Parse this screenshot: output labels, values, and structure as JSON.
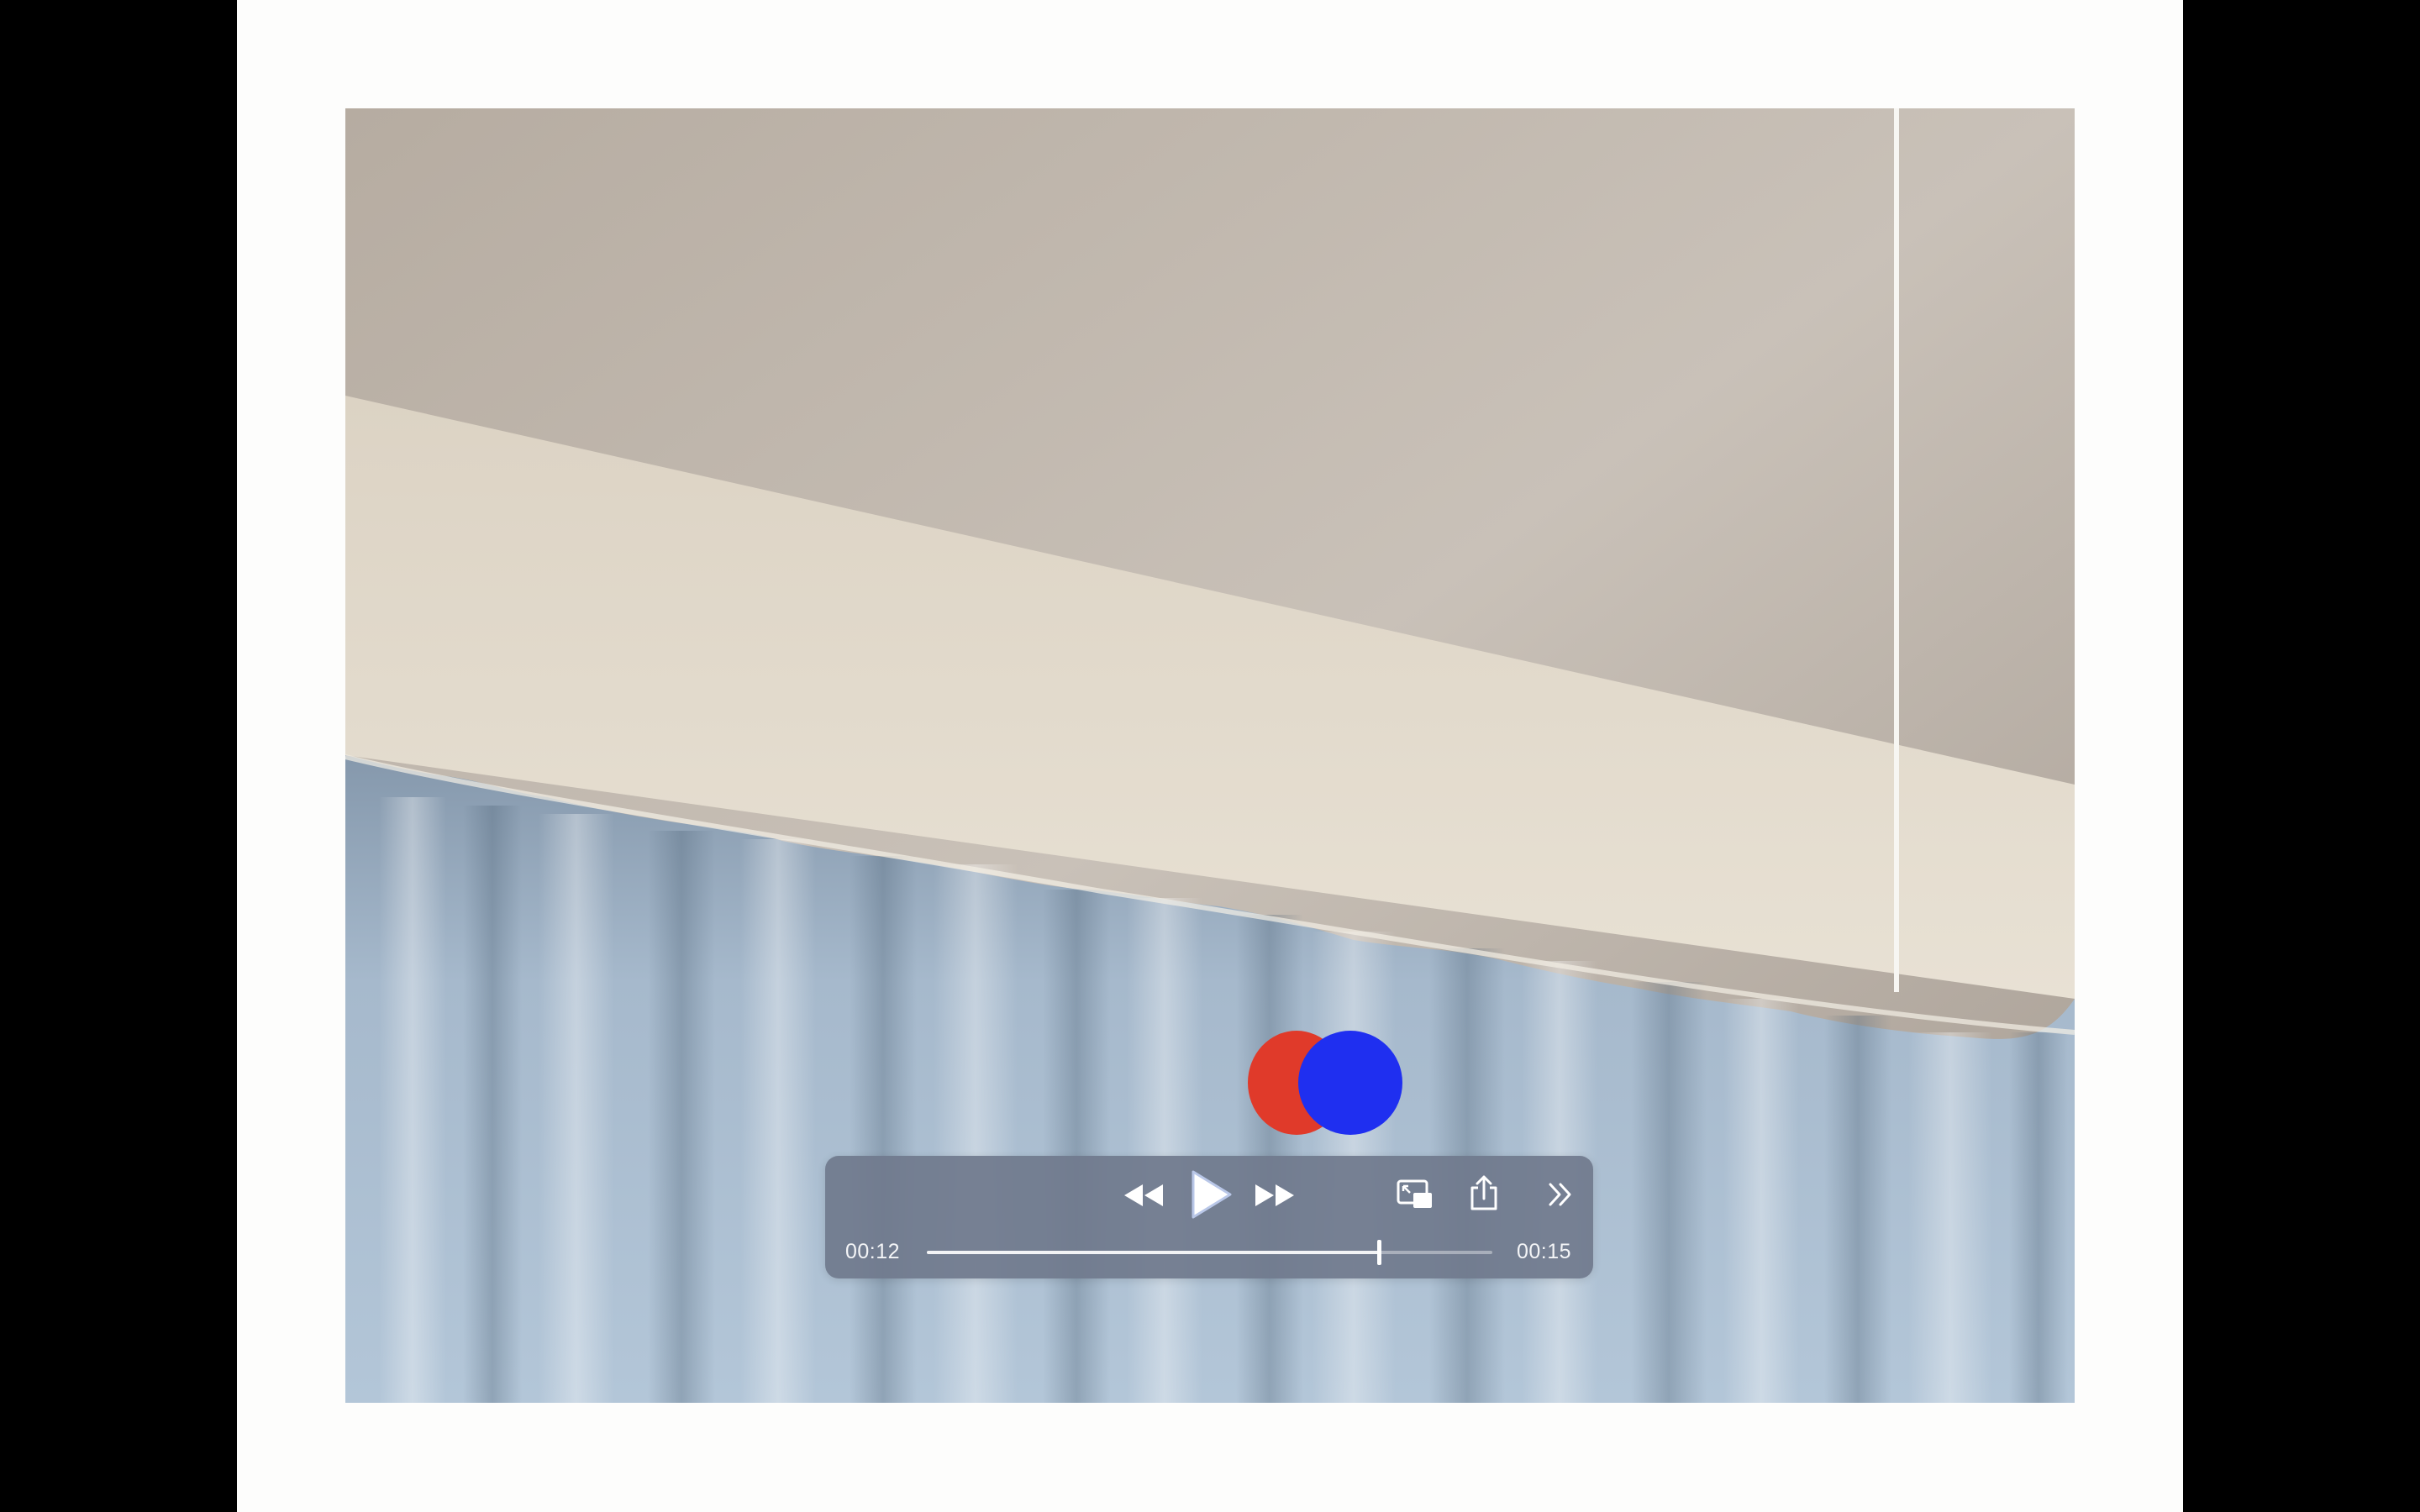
{
  "player": {
    "current_time": "00:12",
    "duration": "00:15",
    "progress": 0.8,
    "state": "paused"
  },
  "controls": {
    "rewind_icon": "rewind-icon",
    "play_icon": "play-icon",
    "fast_forward_icon": "fast-forward-icon",
    "pip_icon": "picture-in-picture-icon",
    "share_icon": "share-icon",
    "more_icon": "chevron-double-right-icon"
  },
  "colors": {
    "controls_background": "#707a8d",
    "red_dot": "#e03a2a",
    "blue_dot": "#1f2ff0"
  }
}
